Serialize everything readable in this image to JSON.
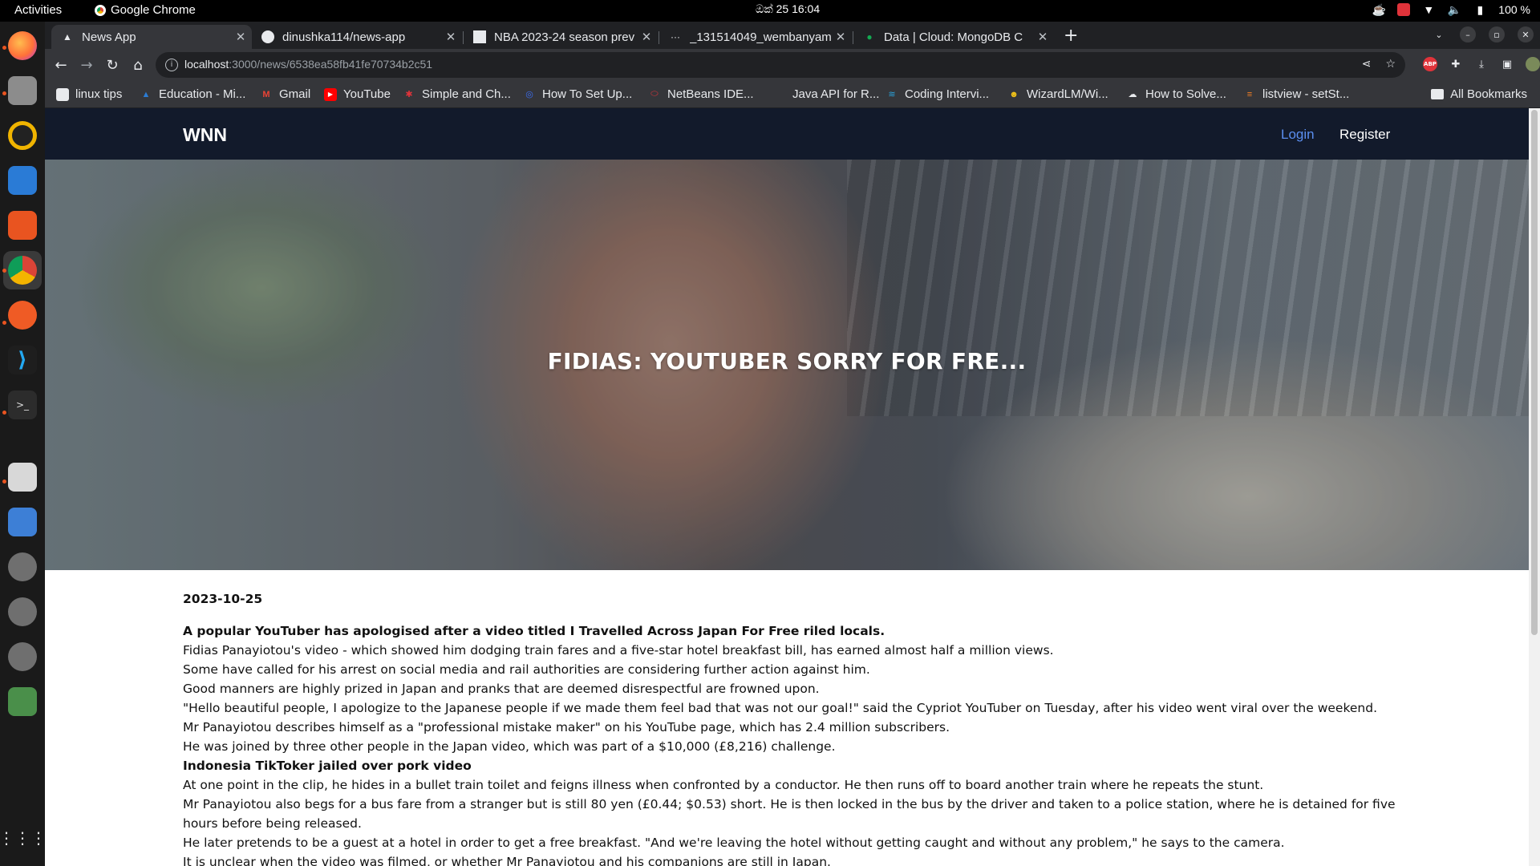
{
  "topbar": {
    "activities": "Activities",
    "app": "Google Chrome",
    "clock": "ඔක් 25  16:04",
    "battery": "100 %"
  },
  "dock": {
    "icons": [
      "firefox-icon",
      "files-icon",
      "rhythmbox-icon",
      "writer-icon",
      "software-icon",
      "chrome-icon",
      "postman-icon",
      "vscode-icon",
      "terminal-icon",
      "reader-icon",
      "text-editor-icon",
      "disk-icon",
      "disk-icon",
      "disk-icon",
      "trash-icon",
      "apps-grid-icon"
    ]
  },
  "browser": {
    "tabs": [
      {
        "title": "News App",
        "active": true
      },
      {
        "title": "dinushka114/news-app"
      },
      {
        "title": "NBA 2023-24 season prev"
      },
      {
        "title": "_131514049_wembanyam"
      },
      {
        "title": "Data | Cloud: MongoDB C"
      }
    ],
    "url_host": "localhost",
    "url_path": ":3000/news/6538ea58fb41fe70734b2c51",
    "bookmarks": [
      "linux tips",
      "Education - Mi...",
      "Gmail",
      "YouTube",
      "Simple and Ch...",
      "How To Set Up...",
      "NetBeans IDE...",
      "Java API for R...",
      "Coding Intervi...",
      "WizardLM/Wi...",
      "How to Solve...",
      "listview - setSt..."
    ],
    "all_bookmarks": "All Bookmarks"
  },
  "site": {
    "brand": "WNN",
    "login": "Login",
    "register": "Register",
    "hero_title": "FIDIAS: YOUTUBER SORRY FOR FRE..."
  },
  "article": {
    "date": "2023-10-25",
    "paragraphs": [
      {
        "text": "A popular YouTuber has apologised after a video titled I Travelled Across Japan For Free riled locals.",
        "bold": true
      },
      {
        "text": "Fidias Panayiotou's video - which showed him dodging train fares and a five-star hotel breakfast bill, has earned almost half a million views."
      },
      {
        "text": "Some have called for his arrest on social media and rail authorities are considering further action against him."
      },
      {
        "text": "Good manners are highly prized in Japan and pranks that are deemed disrespectful are frowned upon."
      },
      {
        "text": "\"Hello beautiful people, I apologize to the Japanese people if we made them feel bad that was not our goal!\" said the Cypriot YouTuber on Tuesday, after his video went viral over the weekend."
      },
      {
        "text": "Mr Panayiotou describes himself as a \"professional mistake maker\" on his YouTube page, which has 2.4 million subscribers."
      },
      {
        "text": "He was joined by three other people in the Japan video, which was part of a $10,000 (£8,216) challenge."
      },
      {
        "text": "Indonesia TikToker jailed over pork video",
        "bold": true
      },
      {
        "text": "At one point in the clip, he hides in a bullet train toilet and feigns illness when confronted by a conductor. He then runs off to board another train where he repeats the stunt."
      },
      {
        "text": "Mr Panayiotou also begs for a bus fare from a stranger but is still 80 yen (£0.44; $0.53) short. He is then locked in the bus by the driver and taken to a police station, where he is detained for five hours before being released."
      },
      {
        "text": "He later pretends to be a guest at a hotel in order to get a free breakfast. \"And we're leaving the hotel without getting caught and without any problem,\" he says to the camera."
      },
      {
        "text": "It is unclear when the video was filmed, or whether Mr Panayiotou and his companions are still in Japan."
      }
    ]
  },
  "colors": {
    "site_nav_bg": "#121a2b",
    "login_link": "#5b8ff0",
    "chrome_dark": "#202124",
    "chrome_toolbar": "#35363a"
  }
}
